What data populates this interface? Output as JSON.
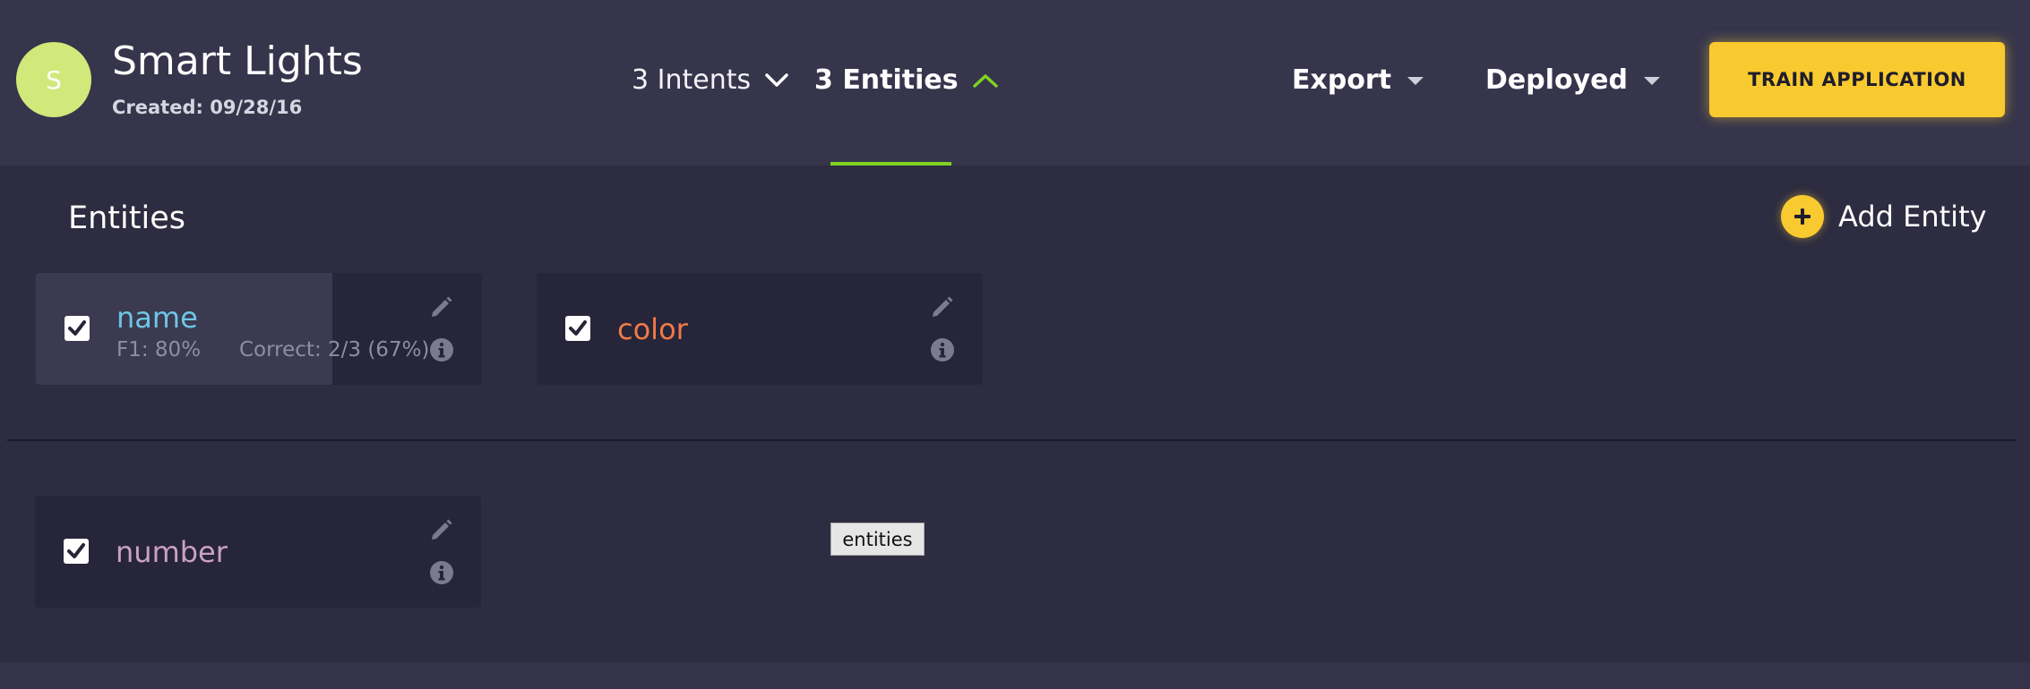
{
  "app": {
    "avatar_letter": "S",
    "title": "Smart Lights",
    "created": "Created: 09/28/16"
  },
  "nav": {
    "intents_label": "3 Intents",
    "entities_label": "3 Entities"
  },
  "header_actions": {
    "export_label": "Export",
    "deployed_label": "Deployed",
    "train_label": "TRAIN APPLICATION"
  },
  "entities_section": {
    "title": "Entities",
    "add_label": "Add Entity"
  },
  "entities": [
    {
      "name": "name",
      "color": "#6ec6e6",
      "checked": true,
      "f1": "F1: 80%",
      "correct": "Correct: 2/3 (67%)"
    },
    {
      "name": "color",
      "color": "#f07a46",
      "checked": true
    },
    {
      "name": "number",
      "color": "#c9a2bf",
      "checked": true
    }
  ],
  "tooltip": "entities",
  "colors": {
    "accent_yellow": "#f9ca2f",
    "active_underline": "#7ed321",
    "avatar": "#d1e87a"
  }
}
